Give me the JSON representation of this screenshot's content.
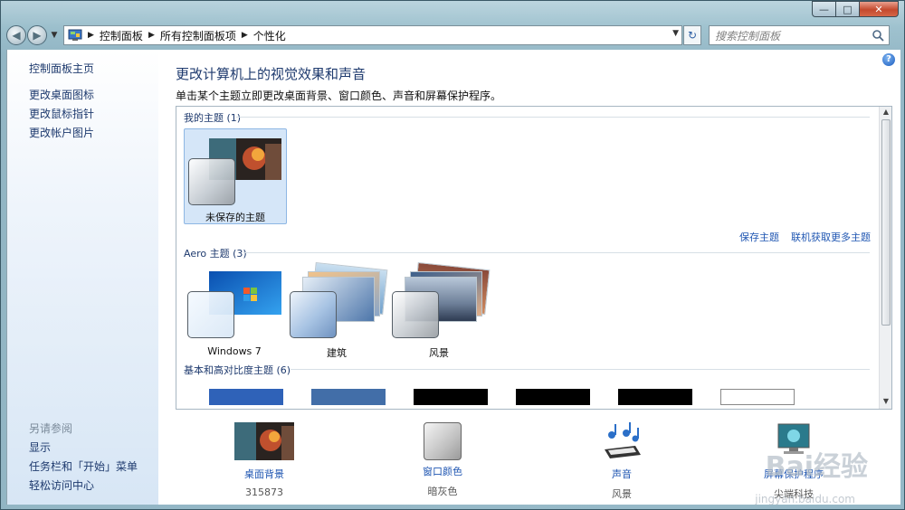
{
  "window": {
    "caption_buttons": [
      "—",
      "□",
      "✕"
    ]
  },
  "address": {
    "crumbs": [
      "控制面板",
      "所有控制面板项",
      "个性化"
    ],
    "search_placeholder": "搜索控制面板"
  },
  "sidebar": {
    "top_links": [
      "控制面板主页",
      "更改桌面图标",
      "更改鼠标指针",
      "更改帐户图片"
    ],
    "see_also_heading": "另请参阅",
    "see_also_links": [
      "显示",
      "任务栏和「开始」菜单",
      "轻松访问中心"
    ]
  },
  "main": {
    "title": "更改计算机上的视觉效果和声音",
    "subtitle": "单击某个主题立即更改桌面背景、窗口颜色、声音和屏幕保护程序。",
    "my_themes_heading": "我的主题 (1)",
    "my_themes": [
      {
        "label": "未保存的主题",
        "selected": true
      }
    ],
    "save_theme_link": "保存主题",
    "get_more_link": "联机获取更多主题",
    "aero_heading": "Aero 主题 (3)",
    "aero_themes": [
      {
        "label": "Windows 7"
      },
      {
        "label": "建筑"
      },
      {
        "label": "风景"
      }
    ],
    "basic_heading": "基本和高对比度主题 (6)",
    "basic_theme_colors": [
      "#2f62b8",
      "#426ea8",
      "#000000",
      "#000000",
      "#000000",
      "#ffffff"
    ]
  },
  "bottom": {
    "items": [
      {
        "label": "桌面背景",
        "value": "315873",
        "icon": "wallpaper-icon"
      },
      {
        "label": "窗口颜色",
        "value": "暗灰色",
        "icon": "window-color-icon"
      },
      {
        "label": "声音",
        "value": "风景",
        "icon": "music-notes-icon"
      },
      {
        "label": "屏幕保护程序",
        "value": "尖端科技",
        "icon": "screensaver-icon"
      }
    ]
  },
  "watermark": {
    "brand": "Bai经验",
    "site": "jingyan.baidu.com"
  },
  "colors": {
    "link": "#1f56b2",
    "heading": "#1e3a6e",
    "selected": "#d5e6f8"
  }
}
